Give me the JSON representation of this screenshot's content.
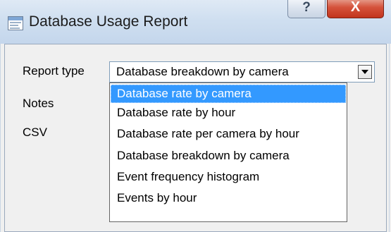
{
  "window": {
    "title": "Database Usage Report",
    "help_glyph": "?",
    "close_glyph": "X"
  },
  "form": {
    "report_type_label": "Report type",
    "notes_label": "Notes",
    "csv_label": "CSV",
    "report_type_value": "Database breakdown by camera"
  },
  "dropdown": {
    "items": [
      {
        "label": "Database rate by camera",
        "selected": true
      },
      {
        "label": "Database rate by hour",
        "selected": false
      },
      {
        "label": "Database rate per camera by hour",
        "selected": false
      },
      {
        "label": "Database breakdown by camera",
        "selected": false
      },
      {
        "label": "Event frequency histogram",
        "selected": false
      },
      {
        "label": "Events by hour",
        "selected": false
      }
    ]
  },
  "colors": {
    "selection": "#3399ff",
    "close_button": "#c2341c",
    "titlebar": "#cfdff0"
  }
}
